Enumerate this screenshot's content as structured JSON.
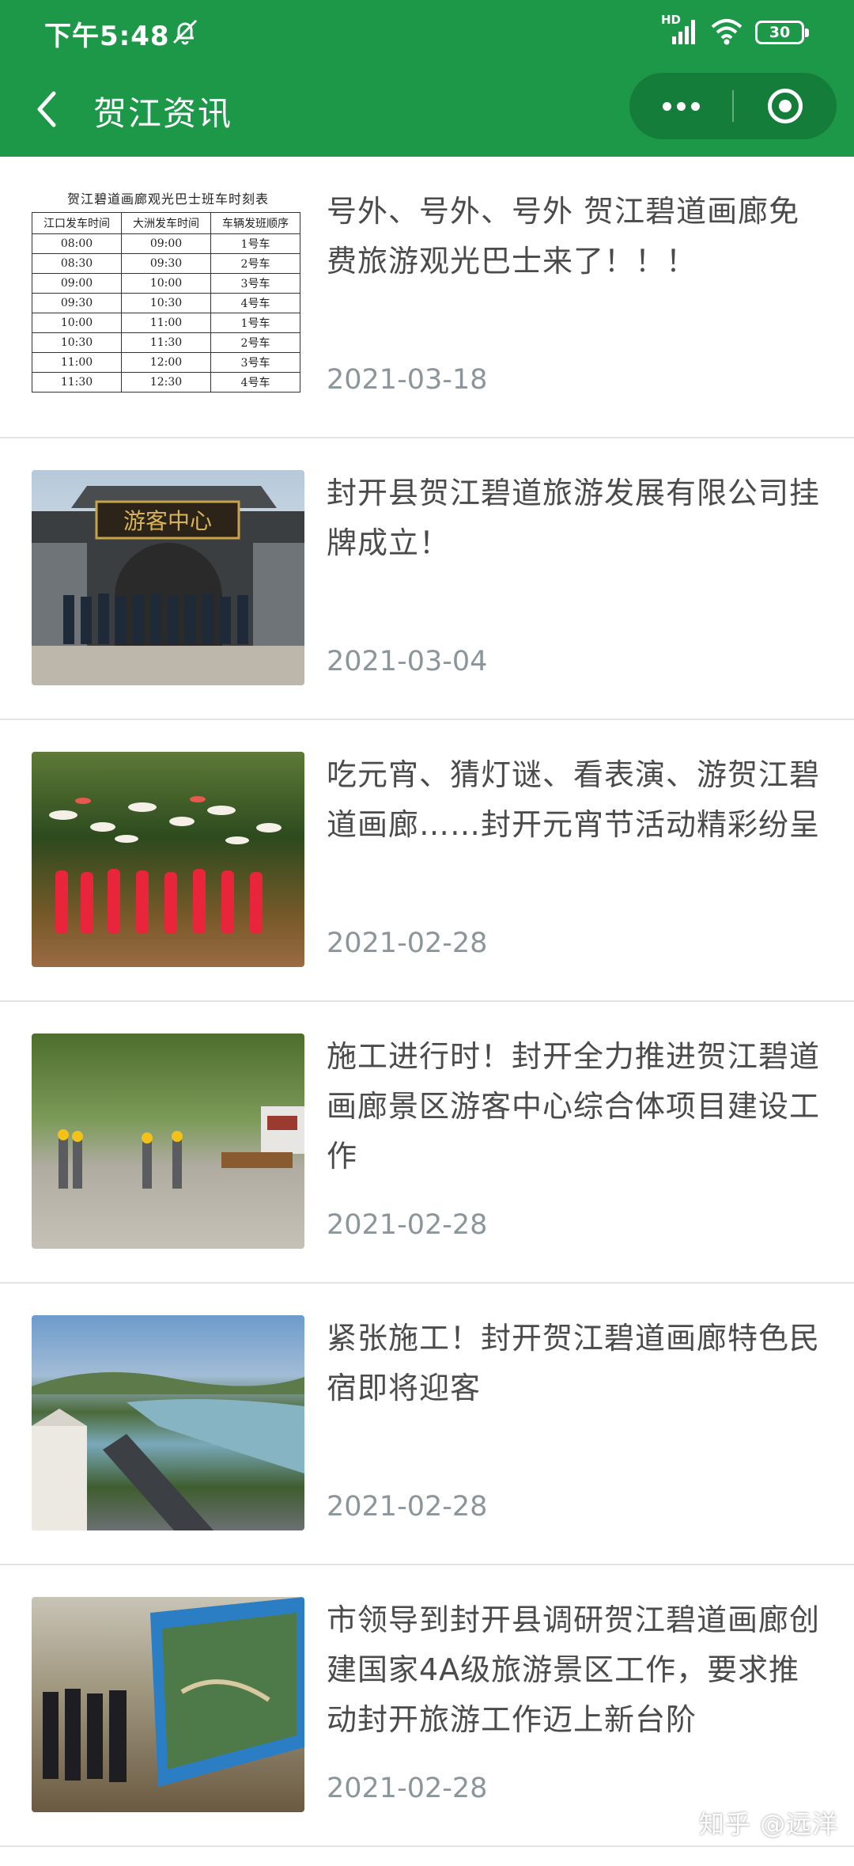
{
  "status_bar": {
    "time": "下午5:48",
    "hd_label": "HD",
    "battery": "30"
  },
  "nav": {
    "title": "贺江资讯"
  },
  "timetable": {
    "title": "贺江碧道画廊观光巴士班车时刻表",
    "headers": [
      "江口发车时间",
      "大洲发车时间",
      "车辆发班顺序"
    ],
    "rows": [
      [
        "08:00",
        "09:00",
        "1号车"
      ],
      [
        "08:30",
        "09:30",
        "2号车"
      ],
      [
        "09:00",
        "10:00",
        "3号车"
      ],
      [
        "09:30",
        "10:30",
        "4号车"
      ],
      [
        "10:00",
        "11:00",
        "1号车"
      ],
      [
        "10:30",
        "11:30",
        "2号车"
      ],
      [
        "11:00",
        "12:00",
        "3号车"
      ],
      [
        "11:30",
        "12:30",
        "4号车"
      ]
    ]
  },
  "news": [
    {
      "title": "号外、号外、号外 贺江碧道画廊免费旅游观光巴士来了！！！",
      "date": "2021-03-18"
    },
    {
      "title": "封开县贺江碧道旅游发展有限公司挂牌成立！",
      "date": "2021-03-04",
      "sign": "游客中心"
    },
    {
      "title": "吃元宵、猜灯谜、看表演、游贺江碧道画廊……封开元宵节活动精彩纷呈",
      "date": "2021-02-28"
    },
    {
      "title": "施工进行时！封开全力推进贺江碧道画廊景区游客中心综合体项目建设工作",
      "date": "2021-02-28"
    },
    {
      "title": "紧张施工！封开贺江碧道画廊特色民宿即将迎客",
      "date": "2021-02-28"
    },
    {
      "title": "市领导到封开县调研贺江碧道画廊创建国家4A级旅游景区工作，要求推动封开旅游工作迈上新台阶",
      "date": "2021-02-28"
    }
  ],
  "watermark": "知乎 @远洋"
}
